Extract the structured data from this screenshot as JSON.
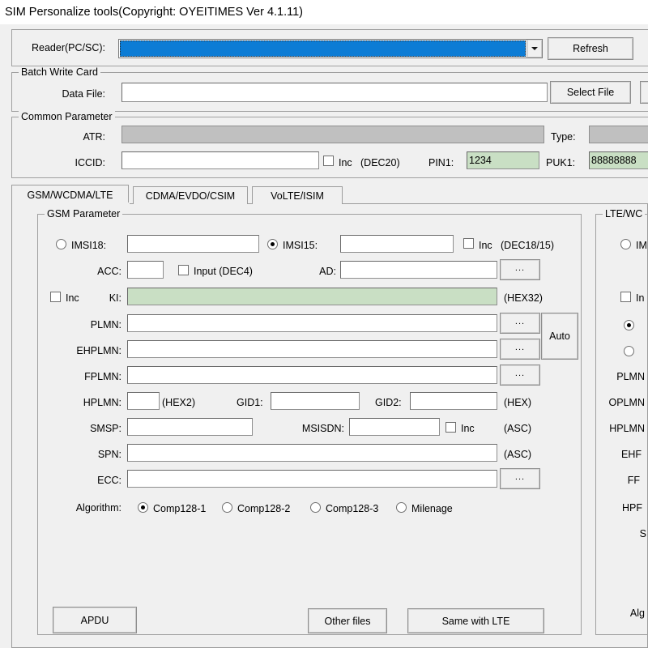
{
  "window": {
    "title": "SIM Personalize tools(Copyright: OYEITIMES Ver 4.1.11)"
  },
  "reader": {
    "label": "Reader(PC/SC):",
    "selected_value": "",
    "dropdown_icon": "chevron-down-icon",
    "refresh_label": "Refresh"
  },
  "batch_write_card": {
    "group_title": "Batch Write Card",
    "data_file_label": "Data File:",
    "data_file_value": "",
    "select_file_label": "Select File",
    "extra_button_label": ""
  },
  "common_parameter": {
    "group_title": "Common Parameter",
    "atr_label": "ATR:",
    "atr_value": "",
    "type_label": "Type:",
    "type_value": "",
    "iccid_label": "ICCID:",
    "iccid_value": "",
    "iccid_inc_label": "Inc",
    "iccid_hint": "(DEC20)",
    "pin1_label": "PIN1:",
    "pin1_value": "1234",
    "puk1_label": "PUK1:",
    "puk1_value": "88888888"
  },
  "tabs": [
    {
      "label": "GSM/WCDMA/LTE",
      "active": true
    },
    {
      "label": "CDMA/EVDO/CSIM",
      "active": false
    },
    {
      "label": "VoLTE/ISIM",
      "active": false
    }
  ],
  "gsm_parameter": {
    "group_title": "GSM Parameter",
    "imsi18_label": "IMSI18:",
    "imsi18_value": "",
    "imsi18_selected": false,
    "imsi15_label": "IMSI15:",
    "imsi15_value": "",
    "imsi15_selected": true,
    "imsi_inc_label": "Inc",
    "imsi_hint": "(DEC18/15)",
    "acc_label": "ACC:",
    "acc_value": "",
    "acc_input_label": "Input (DEC4)",
    "ad_label": "AD:",
    "ad_value": "",
    "ad_browse_label": "...",
    "ki_inc_label": "Inc",
    "ki_label": "KI:",
    "ki_value": "",
    "ki_hint": "(HEX32)",
    "plmn_label": "PLMN:",
    "plmn_value": "",
    "plmn_browse_label": "...",
    "ehplmn_label": "EHPLMN:",
    "ehplmn_value": "",
    "ehplmn_browse_label": "...",
    "auto_label": "Auto",
    "fplmn_label": "FPLMN:",
    "fplmn_value": "",
    "fplmn_browse_label": "...",
    "hplmn_label": "HPLMN:",
    "hplmn_value": "",
    "hplmn_hint": "(HEX2)",
    "gid1_label": "GID1:",
    "gid1_value": "",
    "gid2_label": "GID2:",
    "gid2_value": "",
    "gid_hint": "(HEX)",
    "smsp_label": "SMSP:",
    "smsp_value": "",
    "msisdn_label": "MSISDN:",
    "msisdn_value": "",
    "msisdn_inc_label": "Inc",
    "msisdn_hint": "(ASC)",
    "spn_label": "SPN:",
    "spn_value": "",
    "spn_hint": "(ASC)",
    "ecc_label": "ECC:",
    "ecc_value": "",
    "ecc_browse_label": "...",
    "algorithm_label": "Algorithm:",
    "algorithm_options": [
      {
        "label": "Comp128-1",
        "selected": true
      },
      {
        "label": "Comp128-2",
        "selected": false
      },
      {
        "label": "Comp128-3",
        "selected": false
      },
      {
        "label": "Milenage",
        "selected": false
      }
    ]
  },
  "bottom_buttons": {
    "apdu_label": "APDU",
    "other_files_label": "Other files",
    "same_with_lte_label": "Same with LTE"
  },
  "lte_panel": {
    "group_title": "LTE/WC",
    "imsi_label": "IM",
    "inc_label": "In",
    "radio_a_selected": true,
    "radio_b_selected": false,
    "plmn_label": "PLMN",
    "oplmn_label": "OPLMN",
    "hplmn_label": "HPLMN",
    "ehplmn_label": "EHF",
    "fplmn_label": "FF",
    "hpplmn_label": "HPF",
    "s_label": "S",
    "algorithm_label": "Alg"
  },
  "colors": {
    "face": "#f0f0f0",
    "selection_blue": "#0c7cd5",
    "green_field": "#c9dfc4",
    "disabled_field": "#c0c0c0",
    "border": "#8e8e8e"
  }
}
